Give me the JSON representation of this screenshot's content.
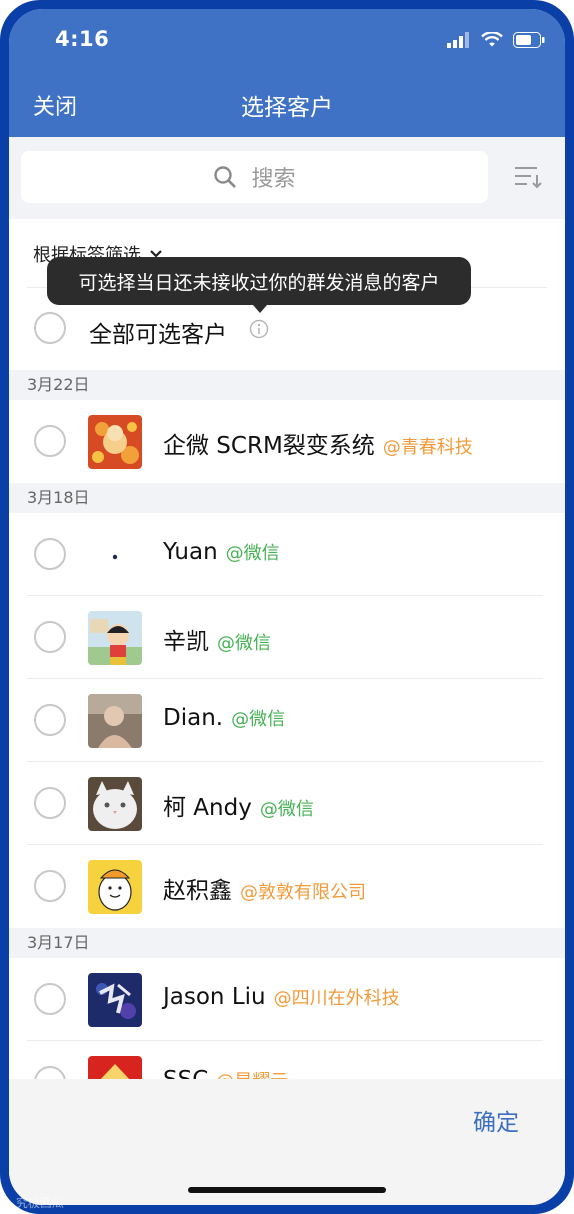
{
  "status_bar": {
    "time": "4:16"
  },
  "nav": {
    "close_label": "关闭",
    "title": "选择客户"
  },
  "search": {
    "placeholder": "搜索"
  },
  "filter": {
    "label": "根据标签筛选"
  },
  "tooltip": {
    "text": "可选择当日还未接收过你的群发消息的客户"
  },
  "select_all": {
    "label": "全部可选客户"
  },
  "groups": [
    {
      "date": "3月22日",
      "customers": [
        {
          "name": "企微 SCRM裂变系统",
          "tag": "@青春科技",
          "tag_color": "orange"
        }
      ]
    },
    {
      "date": "3月18日",
      "customers": [
        {
          "name": "Yuan",
          "tag": "@微信",
          "tag_color": "green"
        },
        {
          "name": "辛凯",
          "tag": "@微信",
          "tag_color": "green"
        },
        {
          "name": "Dian.",
          "tag": "@微信",
          "tag_color": "green"
        },
        {
          "name": "柯 Andy",
          "tag": "@微信",
          "tag_color": "green"
        },
        {
          "name": "赵积鑫",
          "tag": "@敦敦有限公司",
          "tag_color": "orange"
        }
      ]
    },
    {
      "date": "3月17日",
      "customers": [
        {
          "name": "Jason Liu",
          "tag": "@四川在外科技",
          "tag_color": "orange"
        },
        {
          "name": "SSC",
          "tag": "@星耀云",
          "tag_color": "orange"
        }
      ]
    }
  ],
  "footer": {
    "confirm_label": "确定"
  },
  "watermark": {
    "text": "究极西瓜"
  },
  "colors": {
    "header": "#3f72c4",
    "frame": "#0a3fa8",
    "tag_green": "#46b255",
    "tag_orange": "#f29b3a",
    "confirm": "#3d6fc1"
  }
}
